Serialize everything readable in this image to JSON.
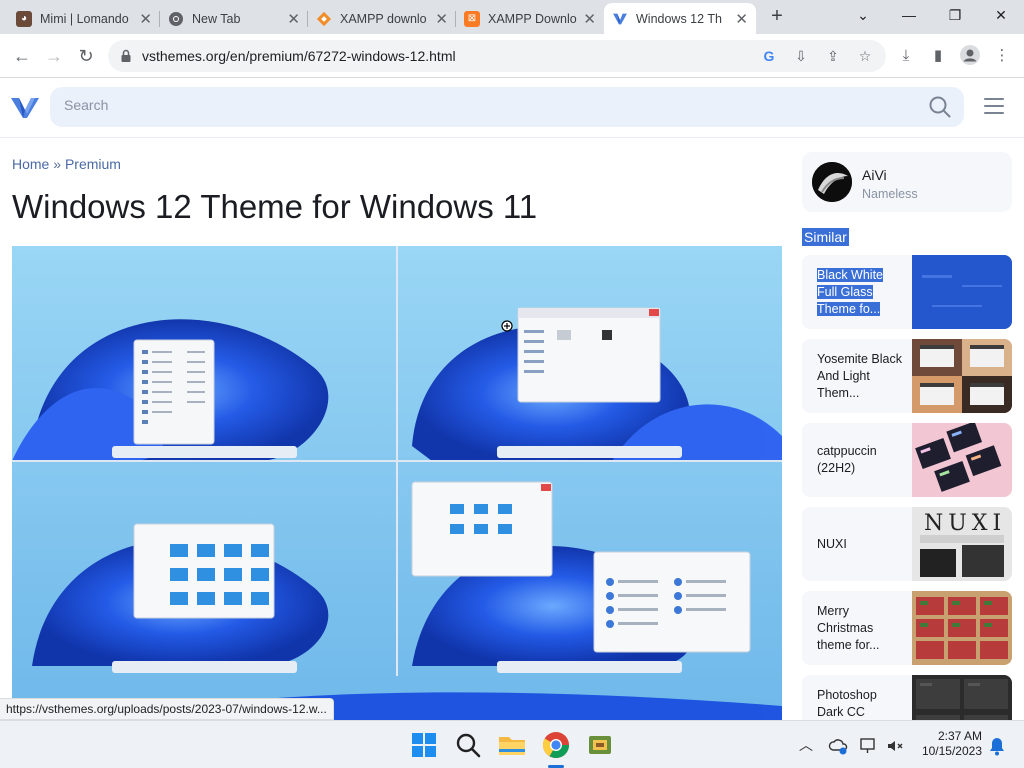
{
  "browser": {
    "tabs": [
      {
        "title": "Mimi | Lomando",
        "active": false
      },
      {
        "title": "New Tab",
        "active": false
      },
      {
        "title": "XAMPP downlo",
        "active": false
      },
      {
        "title": "XAMPP Downlo",
        "active": false
      },
      {
        "title": "Windows 12 Th",
        "active": true
      }
    ],
    "new_tab": "+",
    "window_controls": {
      "chevron": "⌄",
      "minimize": "—",
      "restore": "❐",
      "close": "✕"
    },
    "url": "vsthemes.org/en/premium/67272-windows-12.html"
  },
  "site": {
    "search_placeholder": "Search",
    "breadcrumb": {
      "home": "Home",
      "separator": "»",
      "current": "Premium"
    },
    "title": "Windows 12 Theme for Windows 11",
    "author": {
      "name": "AiVi",
      "role": "Nameless"
    },
    "similar_heading": "Similar",
    "similar": [
      {
        "title": "Black White Full Glass Theme fo..."
      },
      {
        "title": "Yosemite Black And Light Them..."
      },
      {
        "title": "catppuccin (22H2)"
      },
      {
        "title": "NUXI"
      },
      {
        "title": "Merry Christmas theme for..."
      },
      {
        "title": "Photoshop Dark CC"
      }
    ],
    "nuxi_thumb_text": "NUXI"
  },
  "status_url": "https://vsthemes.org/uploads/posts/2023-07/windows-12.w...",
  "taskbar": {
    "time": "2:37 AM",
    "date": "10/15/2023"
  },
  "colors": {
    "accent": "#3a6fd8",
    "hero_sky": "#7fc4ee",
    "bloom": "#1a4fe0"
  }
}
